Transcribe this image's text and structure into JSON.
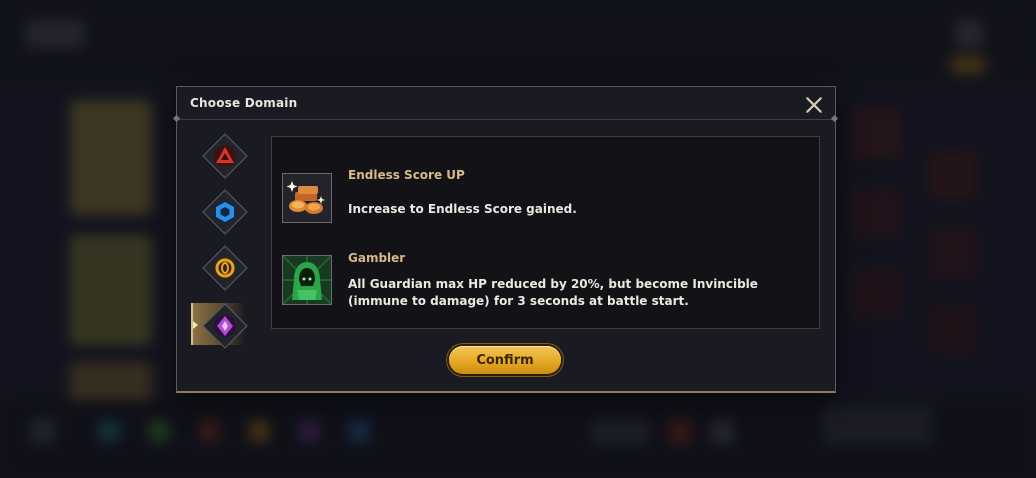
{
  "dialog": {
    "title": "Choose Domain",
    "close_icon": "close-icon"
  },
  "tabs": [
    {
      "name": "red-triangle-domain",
      "color": "#d9342b",
      "active": false
    },
    {
      "name": "blue-hexagon-domain",
      "color": "#2f8de8",
      "active": false
    },
    {
      "name": "gold-ring-domain",
      "color": "#e5a12a",
      "active": false
    },
    {
      "name": "purple-diamond-domain",
      "color": "#b04cd6",
      "active": true
    }
  ],
  "entries": [
    {
      "title": "Endless Score UP",
      "description": "Increase to Endless Score gained.",
      "icon": "gold-coins-icon"
    },
    {
      "title": "Gambler",
      "description": "All Guardian max HP reduced by 20%, but become Invincible (immune to damage) for 3 seconds at battle start.",
      "icon": "hooded-figure-icon"
    }
  ],
  "buttons": {
    "confirm_label": "Confirm"
  },
  "colors": {
    "title_gold": "#d8b989",
    "confirm_gold": "#e5a925"
  }
}
